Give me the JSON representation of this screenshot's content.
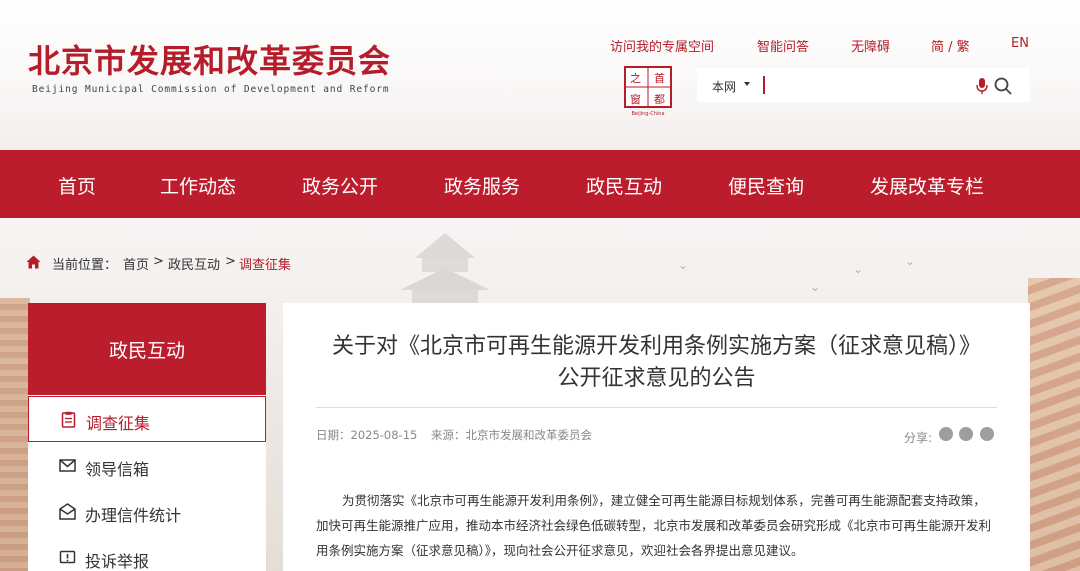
{
  "header": {
    "logo_cn": "北京市发展和改革委员会",
    "logo_en": "Beijing Municipal Commission of Development and Reform",
    "top_links": [
      "访问我的专属空间",
      "智能问答",
      "无障碍",
      "简 / 繁",
      "EN"
    ],
    "capital_logo": {
      "chars": [
        "首",
        "都",
        "之",
        "窗"
      ],
      "caption": "Beijing-China"
    },
    "search": {
      "scope": "本网",
      "placeholder": ""
    }
  },
  "nav": {
    "items": [
      "首页",
      "工作动态",
      "政务公开",
      "政务服务",
      "政民互动",
      "便民查询",
      "发展改革专栏"
    ]
  },
  "breadcrumb": {
    "label": "当前位置：",
    "items": [
      "首页",
      "政民互动",
      "调查征集"
    ],
    "separator": ">"
  },
  "sidebar": {
    "title": "政民互动",
    "items": [
      {
        "label": "调查征集",
        "icon": "clipboard-icon",
        "active": true
      },
      {
        "label": "领导信箱",
        "icon": "mail-icon",
        "active": false
      },
      {
        "label": "办理信件统计",
        "icon": "open-mail-icon",
        "active": false
      },
      {
        "label": "投诉举报",
        "icon": "report-icon",
        "active": false
      }
    ]
  },
  "article": {
    "title": "关于对《北京市可再生能源开发利用条例实施方案（征求意见稿）》公开征求意见的公告",
    "date_label": "日期：2025-08-15",
    "source_label": "来源：北京市发展和改革委员会",
    "share_label": "分享:",
    "body": "为贯彻落实《北京市可再生能源开发利用条例》，建立健全可再生能源目标规划体系，完善可再生能源配套支持政策，加快可再生能源推广应用，推动本市经济社会绿色低碳转型，北京市发展和改革委员会研究形成《北京市可再生能源开发利用条例实施方案（征求意见稿）》，现向社会公开征求意见，欢迎社会各界提出意见建议。"
  },
  "colors": {
    "brand_red": "#bb1d2d",
    "text": "#333333",
    "muted": "#888888"
  }
}
